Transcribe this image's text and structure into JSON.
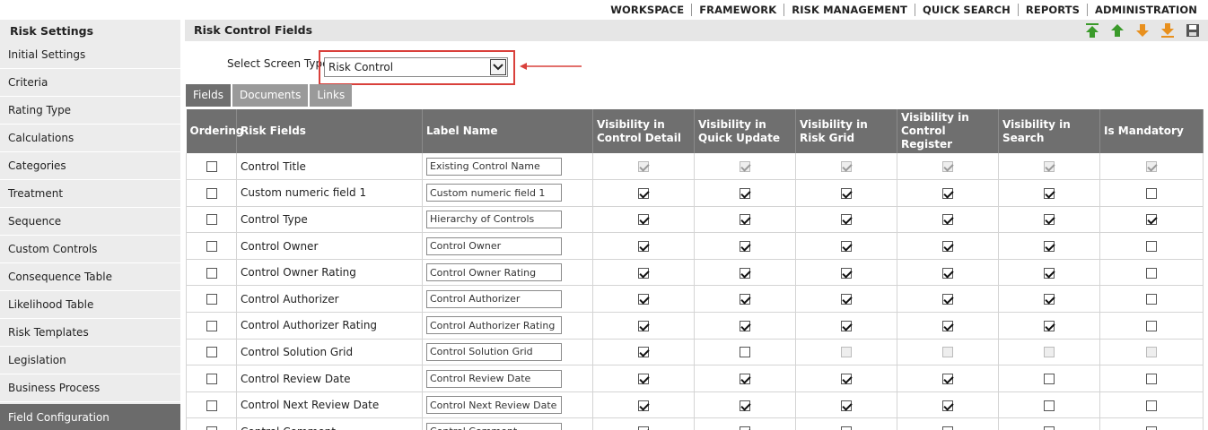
{
  "topnav": [
    "WORKSPACE",
    "FRAMEWORK",
    "RISK MANAGEMENT",
    "QUICK SEARCH",
    "REPORTS",
    "ADMINISTRATION"
  ],
  "sidebar": {
    "title": "Risk Settings",
    "items": [
      {
        "label": "Initial Settings"
      },
      {
        "label": "Criteria"
      },
      {
        "label": "Rating Type"
      },
      {
        "label": "Calculations"
      },
      {
        "label": "Categories"
      },
      {
        "label": "Treatment"
      },
      {
        "label": "Sequence"
      },
      {
        "label": "Custom Controls"
      },
      {
        "label": "Consequence Table"
      },
      {
        "label": "Likelihood Table"
      },
      {
        "label": "Risk Templates"
      },
      {
        "label": "Legislation"
      },
      {
        "label": "Business Process"
      },
      {
        "label": "Field Configuration",
        "active": true
      }
    ]
  },
  "main": {
    "title": "Risk Control Fields",
    "toolbar": [
      {
        "name": "move-top-icon",
        "color": "#3a9a2a"
      },
      {
        "name": "move-up-icon",
        "color": "#3a9a2a"
      },
      {
        "name": "move-down-icon",
        "color": "#e8901e"
      },
      {
        "name": "move-bottom-icon",
        "color": "#e8901e"
      },
      {
        "name": "save-icon",
        "color": "#555555"
      }
    ],
    "screen_type": {
      "label": "Select Screen Type :",
      "value": "Risk Control"
    },
    "tabs": [
      {
        "label": "Fields",
        "active": true
      },
      {
        "label": "Documents",
        "active": false
      },
      {
        "label": "Links",
        "active": false
      }
    ],
    "columns": [
      "Ordering",
      "Risk Fields",
      "Label Name",
      "Visibility in Control Detail",
      "Visibility in Quick Update",
      "Visibility in Risk Grid",
      "Visibility in Control Register",
      "Visibility in Search",
      "Is Mandatory"
    ],
    "rows": [
      {
        "field": "Control Title",
        "label": "Existing Control Name",
        "flags": [
          "cd",
          "cd",
          "cd",
          "cd",
          "cd",
          "cd"
        ]
      },
      {
        "field": "Custom numeric field 1",
        "label": "Custom numeric field 1",
        "flags": [
          "c",
          "c",
          "c",
          "c",
          "c",
          "u"
        ]
      },
      {
        "field": "Control Type",
        "label": "Hierarchy of Controls",
        "flags": [
          "c",
          "c",
          "c",
          "c",
          "c",
          "c"
        ]
      },
      {
        "field": "Control Owner",
        "label": "Control Owner",
        "flags": [
          "c",
          "c",
          "c",
          "c",
          "c",
          "u"
        ]
      },
      {
        "field": "Control Owner Rating",
        "label": "Control Owner Rating",
        "flags": [
          "c",
          "c",
          "c",
          "c",
          "c",
          "u"
        ]
      },
      {
        "field": "Control Authorizer",
        "label": "Control Authorizer",
        "flags": [
          "c",
          "c",
          "c",
          "c",
          "c",
          "u"
        ]
      },
      {
        "field": "Control Authorizer Rating",
        "label": "Control Authorizer Rating",
        "flags": [
          "c",
          "c",
          "c",
          "c",
          "c",
          "u"
        ]
      },
      {
        "field": "Control Solution Grid",
        "label": "Control Solution Grid",
        "flags": [
          "c",
          "u",
          "ud",
          "ud",
          "ud",
          "ud"
        ]
      },
      {
        "field": "Control Review Date",
        "label": "Control Review Date",
        "flags": [
          "c",
          "c",
          "c",
          "c",
          "u",
          "u"
        ]
      },
      {
        "field": "Control Next Review Date",
        "label": "Control Next Review Date",
        "flags": [
          "c",
          "c",
          "c",
          "c",
          "u",
          "u"
        ]
      },
      {
        "field": "Control Comment",
        "label": "Control Comment",
        "flags": [
          "c",
          "c",
          "u",
          "u",
          "u",
          "u"
        ]
      }
    ]
  }
}
